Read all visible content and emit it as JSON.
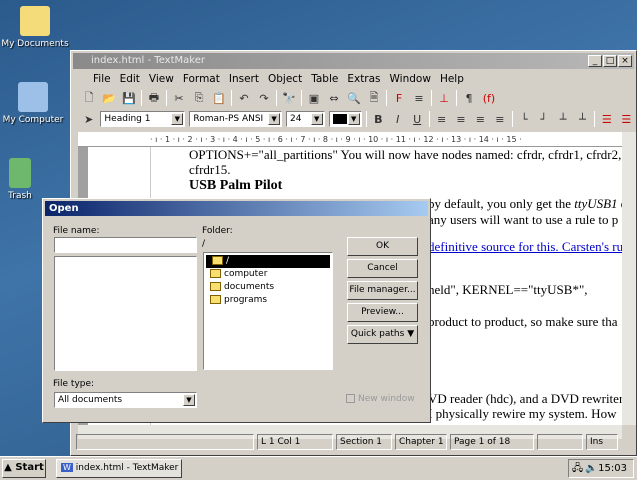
{
  "desktop": {
    "icons": [
      {
        "label": "My Documents"
      },
      {
        "label": "My Computer"
      },
      {
        "label": "Trash"
      }
    ]
  },
  "window": {
    "title": "index.html - TextMaker",
    "menu": [
      "File",
      "Edit",
      "View",
      "Format",
      "Insert",
      "Object",
      "Table",
      "Extras",
      "Window",
      "Help"
    ],
    "format": {
      "style": "Heading 1",
      "font": "Roman-PS ANSI",
      "size": "24"
    },
    "ruler": "· ı · 1 · ı · 2 · ı · 3 · ı · 4 · ı · 5 · ı · 6 · ı · 7 · ı · 8 · ı · 9 · ı · 10 · ı · 11 · ı · 12 · ı · 13 · ı · 14 · ı · 15 ·",
    "doc": {
      "line1": "OPTIONS+=\"all_partitions\" You will now have nodes named: cfrdr, cfrdr1, cfrdr2,",
      "line2": "cfrdr15.",
      "heading": "USB Palm Pilot",
      "line3a": "by default, you only get the ",
      "line3b": "ttyUSB1",
      "line3c": " d",
      "line4": "any users will want to use a rule to p",
      "link": "definitive source for this. Carsten's ru",
      "line5": "held\", KERNEL==\"ttyUSB*\",",
      "line6": "product to product, so make sure tha",
      "line7": "VD reader (hdc), and a DVD rewriter",
      "line8": "I physically rewire my system. How"
    },
    "status": {
      "pos": "L 1 Col 1",
      "section": "Section 1",
      "chapter": "Chapter 1",
      "page": "Page 1 of 18",
      "mode": "Ins"
    }
  },
  "dialog": {
    "title": "Open",
    "file_name_label": "File name:",
    "file_name_value": "",
    "folder_label": "Folder:",
    "folder_path": "/",
    "folders": [
      "/",
      "computer",
      "documents",
      "programs"
    ],
    "file_type_label": "File type:",
    "file_type_value": "All documents",
    "buttons": {
      "ok": "OK",
      "cancel": "Cancel",
      "file_manager": "File manager...",
      "preview": "Preview...",
      "quick_paths": "Quick paths"
    },
    "new_window": "New window"
  },
  "taskbar": {
    "start": "Start",
    "task": "index.html - TextMaker",
    "clock": "15:03"
  }
}
